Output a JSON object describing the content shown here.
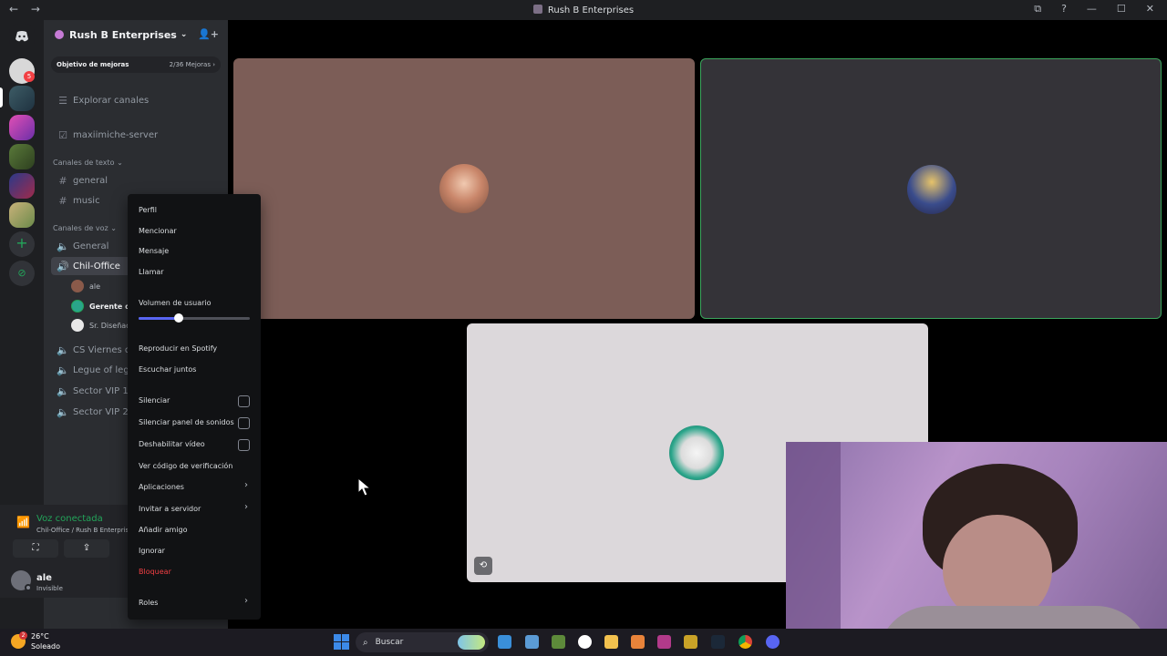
{
  "window": {
    "title": "Rush B Enterprises",
    "nav_back": "←",
    "nav_forward": "→",
    "controls": [
      "⧉",
      "?",
      "—",
      "☐",
      "✕"
    ]
  },
  "rail": {
    "home_icon": "discord-icon",
    "badges": [
      "5"
    ],
    "add_icon": "+",
    "explore_icon": "⊘"
  },
  "server": {
    "name": "Rush B Enterprises",
    "chevron": "⌄",
    "add_member_icon": "👤+",
    "boost_label": "Objetivo de mejoras",
    "boost_progress": "2/36 Mejoras ›"
  },
  "channels": {
    "explore": "Explorar canales",
    "forum": "maxiimiche-server",
    "text_category": "Canales de texto ⌄",
    "text": [
      "general",
      "music"
    ],
    "voice_category": "Canales de voz ⌄",
    "voice": [
      "General",
      "Chil-Office",
      "CS Viernes de",
      "Legue of leger",
      "Sector VIP 1",
      "Sector VIP 2"
    ],
    "members": [
      "ale",
      "Gerente de",
      "Sr. Diseñac"
    ]
  },
  "voice_panel": {
    "status": "Voz conectada",
    "location": "Chil-Office / Rush B Enterprises",
    "buttons": [
      "⛶",
      "⇪"
    ]
  },
  "user": {
    "name": "ale",
    "status": "Invisible"
  },
  "context_menu": {
    "items": [
      "Perfil",
      "Mencionar",
      "Mensaje",
      "Llamar"
    ],
    "volume_label": "Volumen de usuario",
    "volume_value": 0.36,
    "spotify": [
      "Reproducir en Spotify",
      "Escuchar juntos"
    ],
    "toggles": [
      "Silenciar",
      "Silenciar panel de sonidos",
      "Deshabilitar vídeo"
    ],
    "more": [
      "Ver código de verificación",
      "Aplicaciones",
      "Invitar a servidor",
      "Añadir amigo",
      "Ignorar"
    ],
    "danger": "Bloquear",
    "roles": "Roles",
    "arrow": "›"
  },
  "taskbar": {
    "temperature": "26°C",
    "weather": "Soleado",
    "weather_badge": "2",
    "search_placeholder": "Buscar",
    "search_icon": "⌕"
  },
  "tile_icon": "⟲"
}
